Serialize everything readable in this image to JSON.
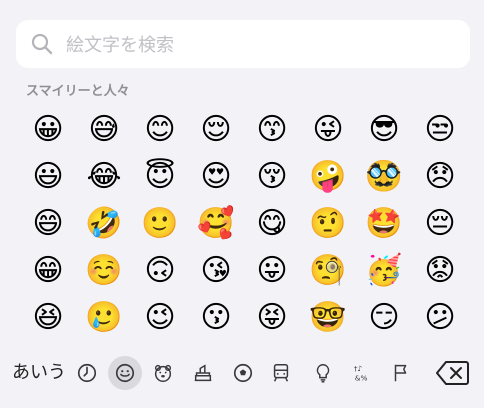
{
  "search": {
    "placeholder": "絵文字を検索"
  },
  "section_title": "スマイリーと人々",
  "emojis": [
    [
      "😀",
      "😅",
      "😊",
      "😌",
      "😙",
      "😜",
      "😎",
      "😒"
    ],
    [
      "😃",
      "😂",
      "😇",
      "😍",
      "😚",
      "🤪",
      "🥸",
      "😞"
    ],
    [
      "😄",
      "🤣",
      "🙂",
      "🥰",
      "😋",
      "🤨",
      "🤩",
      "😔"
    ],
    [
      "😁",
      "☺️",
      "🙃",
      "😘",
      "😛",
      "🧐",
      "🥳",
      "😟"
    ],
    [
      "😆",
      "🥲",
      "😉",
      "😗",
      "😝",
      "🤓",
      "😏",
      "😕"
    ]
  ],
  "keyboard": {
    "switch_label": "あいう",
    "categories": [
      "recent",
      "smileys",
      "animals",
      "food",
      "activity",
      "travel",
      "objects",
      "symbols",
      "flags"
    ],
    "selected_category": "smileys"
  }
}
